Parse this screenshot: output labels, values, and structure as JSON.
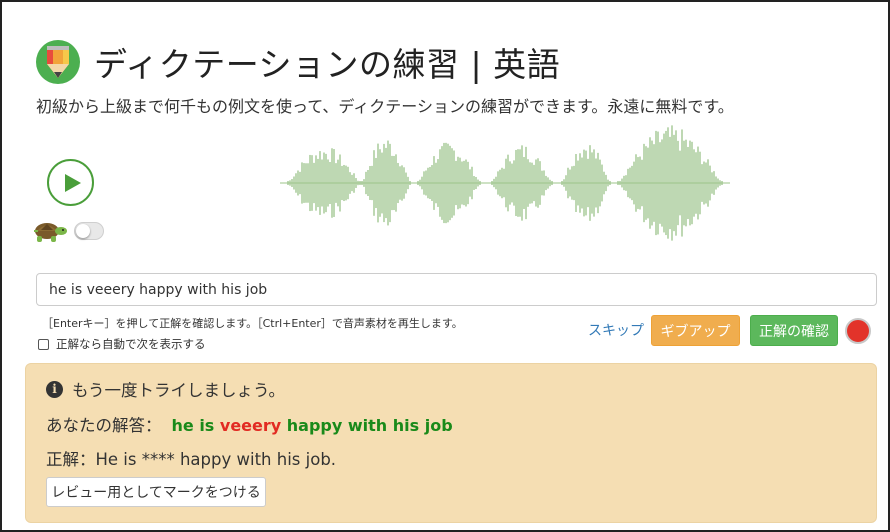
{
  "header": {
    "title": "ディクテーションの練習 | 英語",
    "subtitle": "初級から上級まで何千もの例文を使って、ディクテーションの練習ができます。永遠に無料です。",
    "logo": "pencil-logo"
  },
  "player": {
    "play_icon": "play-icon",
    "slow_icon": "turtle-icon",
    "slow_mode_on": false
  },
  "input": {
    "value": "he is veeery happy with his job"
  },
  "hint": "［Enterキー］を押して正解を確認します。［Ctrl+Enter］で音声素材を再生します。",
  "auto_next": {
    "label": "正解なら自動で次を表示する",
    "checked": false
  },
  "actions": {
    "skip": "スキップ",
    "give_up": "ギブアップ",
    "check": "正解の確認",
    "record_icon": "record-icon"
  },
  "result": {
    "message": "もう一度トライしましょう。",
    "your_answer_label": "あなたの解答：",
    "answer_parts": [
      {
        "text": "he is ",
        "status": "correct"
      },
      {
        "text": "veeery",
        "status": "wrong"
      },
      {
        "text": " happy with his job",
        "status": "correct"
      }
    ],
    "correct_label": "正解：",
    "correct_text": "He is **** happy with his job.",
    "mark_button": "レビュー用としてマークをつける"
  },
  "colors": {
    "accent_green": "#5cb85c",
    "warning_orange": "#f0ad4e",
    "link_blue": "#337ab7",
    "result_bg": "#f5deb3",
    "wrong_red": "#e22b22",
    "ok_green": "#1a8a1a"
  }
}
